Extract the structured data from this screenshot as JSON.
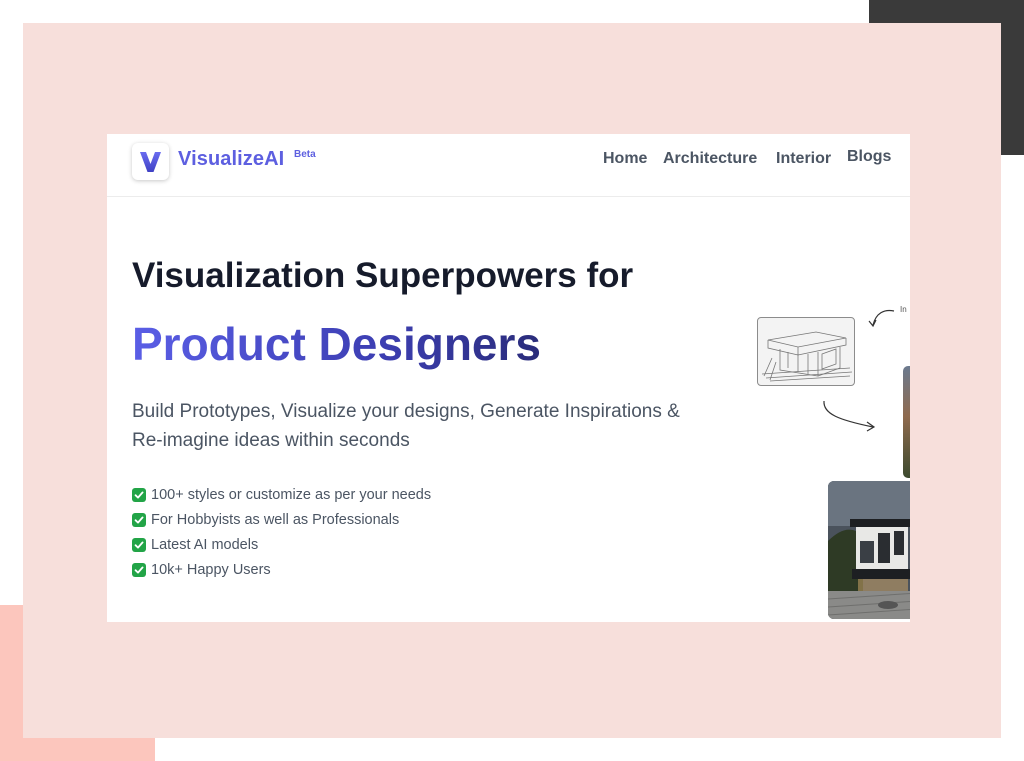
{
  "brand": {
    "name": "VisualizeAI",
    "badge": "Beta",
    "logo_icon": "v-logo-icon",
    "color": "#5d5fe0"
  },
  "nav": {
    "items": [
      {
        "label": "Home"
      },
      {
        "label": "Architecture"
      },
      {
        "label": "Interior"
      },
      {
        "label": "Blogs"
      }
    ]
  },
  "hero": {
    "headline": "Visualization Superpowers for",
    "accent": "Product Designers",
    "subtext": "Build Prototypes, Visualize your designs, Generate Inspirations & Re-imagine ideas within seconds",
    "features": [
      {
        "icon": "check-icon",
        "text": "100+ styles or customize as per your needs"
      },
      {
        "icon": "check-icon",
        "text": "For Hobbyists as well as Professionals"
      },
      {
        "icon": "check-icon",
        "text": "Latest AI models"
      },
      {
        "icon": "check-icon",
        "text": "10k+ Happy Users"
      }
    ],
    "illustration_label": "In"
  },
  "colors": {
    "frame": "#f7dfdb",
    "accent_gradient_start": "#5a5ee6",
    "accent_gradient_end": "#2a2c7a",
    "check_green": "#22a447",
    "deco_dark": "#3a3a3a",
    "deco_salmon": "#fcc6bd"
  }
}
